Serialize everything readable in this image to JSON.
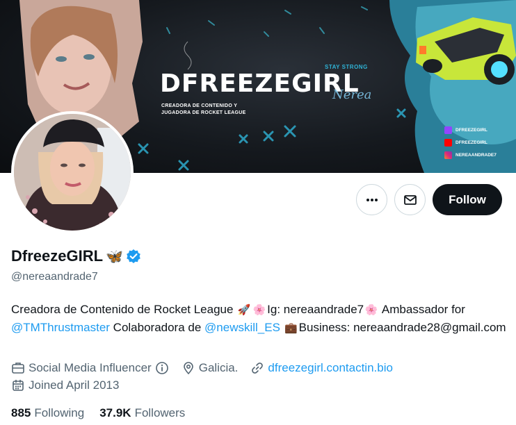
{
  "banner": {
    "title": "DFREEZEGIRL",
    "script_text": "Nerea",
    "tagline": "STAY STRONG",
    "subtitle_line1": "CREADORA DE CONTENIDO Y",
    "subtitle_line2": "JUGADORA DE ROCKET LEAGUE",
    "socials": [
      {
        "icon": "twitch-icon",
        "handle": "DFREEZEGIRL",
        "color": "#9146ff"
      },
      {
        "icon": "youtube-icon",
        "handle": "DFREEZEGIRL",
        "color": "#ff0000"
      },
      {
        "icon": "instagram-icon",
        "handle": "NEREAANDRADE7",
        "color": "#e1306c"
      }
    ]
  },
  "actions": {
    "more_icon": "more-icon",
    "message_icon": "envelope-icon",
    "follow_label": "Follow"
  },
  "profile": {
    "display_name": "DfreezeGIRL",
    "name_emoji": "🦋",
    "verified_icon": "verified-badge-icon",
    "verified_color": "#1d9bf0",
    "handle": "@nereaandrade7",
    "bio": {
      "part1": "Creadora de Contenido de Rocket League ",
      "emoji_rocket": "🚀",
      "emoji_flower1": "🌸",
      "part2": "Ig: nereaandrade7",
      "emoji_flower2": "🌸",
      "part3": " Ambassador for ",
      "mention1": "@TMThrustmaster",
      "part4": " Colaboradora de ",
      "mention2": "@newskill_ES",
      "emoji_briefcase": "💼",
      "part5": "Business: nereaandrade28@gmail.com"
    },
    "category": "Social Media Influencer",
    "location": "Galicia.",
    "website": "dfreezegirl.contactin.bio",
    "joined": "Joined April 2013",
    "following_count": "885",
    "following_label": "Following",
    "followers_count": "37.9K",
    "followers_label": "Followers"
  },
  "colors": {
    "accent": "#1d9bf0",
    "text_primary": "#0f1419",
    "text_secondary": "#536471",
    "follow_bg": "#0f1419"
  }
}
